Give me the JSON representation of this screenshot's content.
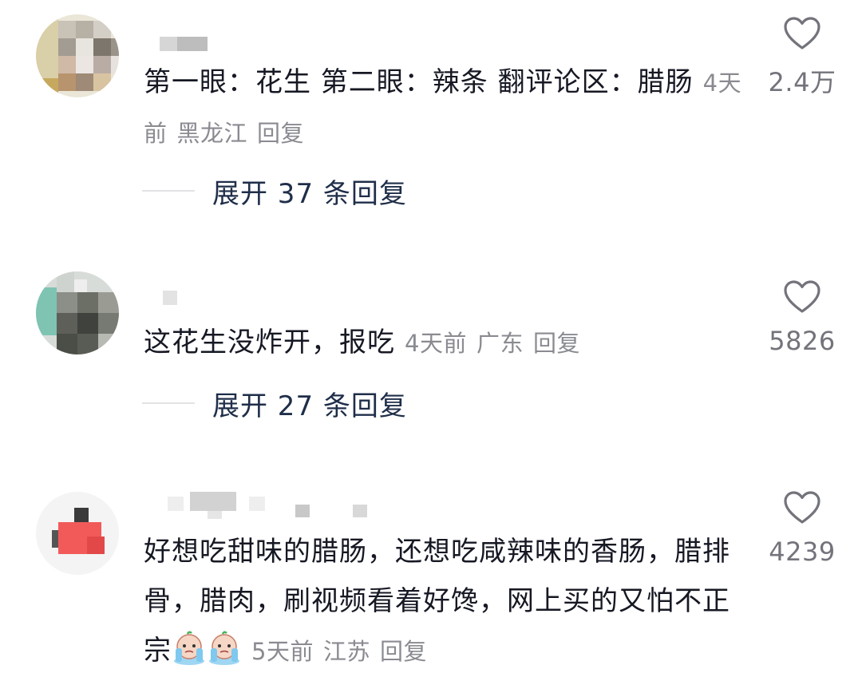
{
  "comments": [
    {
      "text": "第一眼：花生 第二眼：辣条 翻评论区：腊肠",
      "time": "4天前",
      "location": "黑龙江",
      "reply_label": "回复",
      "likes": "2.4万",
      "expand_label": "展开 37 条回复"
    },
    {
      "text": "这花生没炸开，报吃",
      "time": "4天前",
      "location": "广东",
      "reply_label": "回复",
      "likes": "5826",
      "expand_label": "展开 27 条回复"
    },
    {
      "text": "好想吃甜味的腊肠，还想吃咸辣味的香肠，腊排骨，腊肉，刷视频看着好馋，网上买的又怕不正宗",
      "emojis": [
        "crying-face-emoji",
        "crying-face-emoji"
      ],
      "time": "5天前",
      "location": "江苏",
      "reply_label": "回复",
      "likes": "4239"
    }
  ],
  "icons": {
    "like": "heart-outline-icon"
  },
  "colors": {
    "text": "#161823",
    "meta": "#8a8b91",
    "expand": "#1f2e49",
    "like_count": "#73747b"
  }
}
